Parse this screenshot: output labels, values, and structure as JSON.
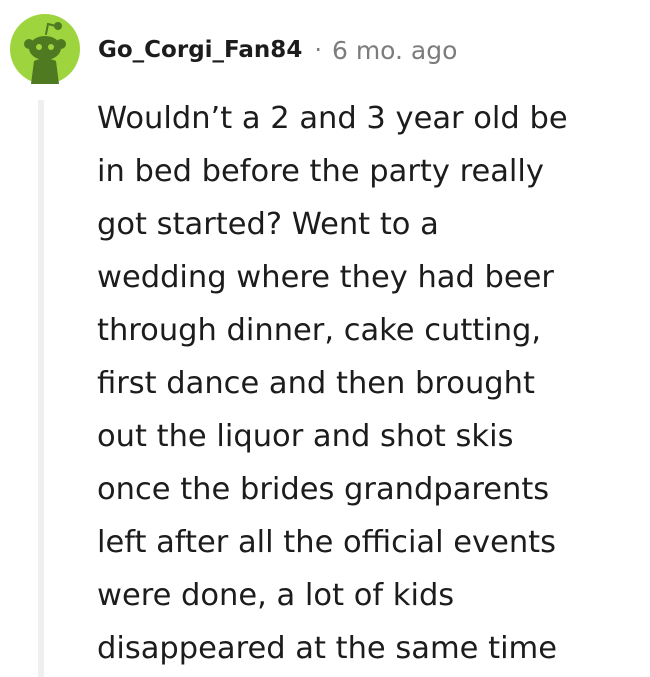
{
  "comment": {
    "author": "Go_Corgi_Fan84",
    "separator": "·",
    "timestamp": "6 mo. ago",
    "avatar_icon": "snoo-avatar-icon",
    "colors": {
      "avatar_bg": "#9ed53e",
      "thread_line": "#edeff1",
      "text": "#1c1c1c",
      "meta": "#7c7c7c"
    },
    "body_lines": [
      "Wouldn’t a 2 and 3 year old be",
      "in bed before the party really",
      "got started? Went to a",
      "wedding where they had beer",
      "through dinner, cake cutting,",
      "first dance and then brought",
      "out the liquor and shot skis",
      "once the brides grandparents",
      "left after all the official events",
      "were done, a lot of kids",
      "disappeared at the same time"
    ]
  }
}
